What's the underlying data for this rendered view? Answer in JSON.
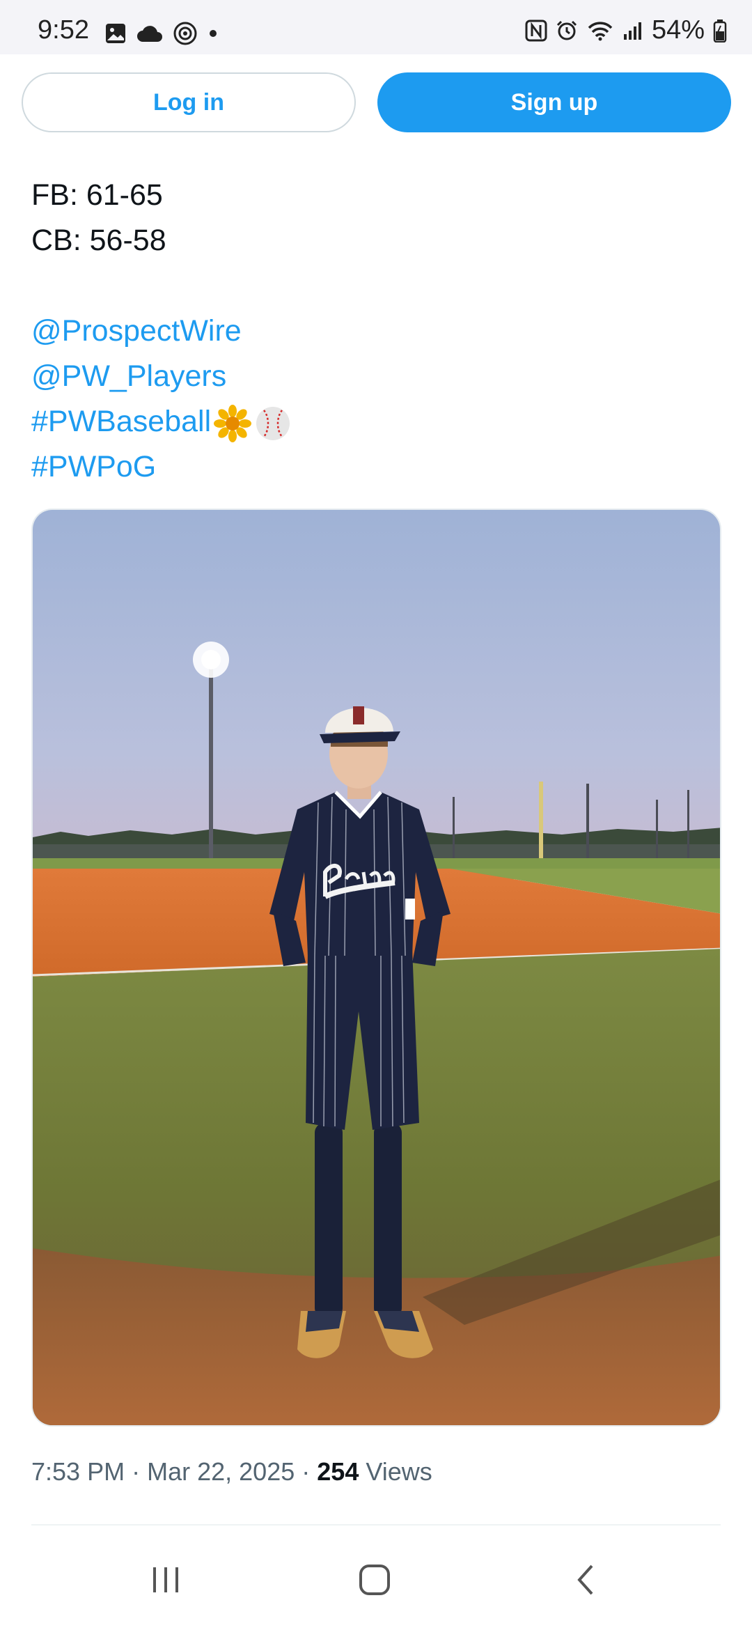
{
  "status_bar": {
    "time": "9:52",
    "battery": "54%",
    "left_icons": [
      "gallery-icon",
      "cloud-icon",
      "threads-icon",
      "dot-icon"
    ],
    "right_icons": [
      "nfc-icon",
      "alarm-icon",
      "wifi-icon",
      "signal-icon",
      "battery-icon"
    ]
  },
  "auth": {
    "login_label": "Log in",
    "signup_label": "Sign up"
  },
  "tweet": {
    "line1": "FB: 61-65",
    "line2": "CB: 56-58",
    "mention1": "@ProspectWire",
    "mention2": "@PW_Players",
    "hashtag1": "#PWBaseball",
    "hashtag1_emojis": [
      "sunflower-icon",
      "baseball-icon"
    ],
    "hashtag2": "#PWPoG"
  },
  "meta": {
    "time": "7:53 PM",
    "date": "Mar 22, 2025",
    "views_count": "254",
    "views_label": "Views",
    "separator": "·"
  },
  "nav_bar": {
    "items": [
      "recent-apps-icon",
      "home-icon",
      "back-icon"
    ]
  },
  "colors": {
    "accent": "#1d9bf0",
    "text": "#0f1419",
    "muted": "#536471"
  }
}
